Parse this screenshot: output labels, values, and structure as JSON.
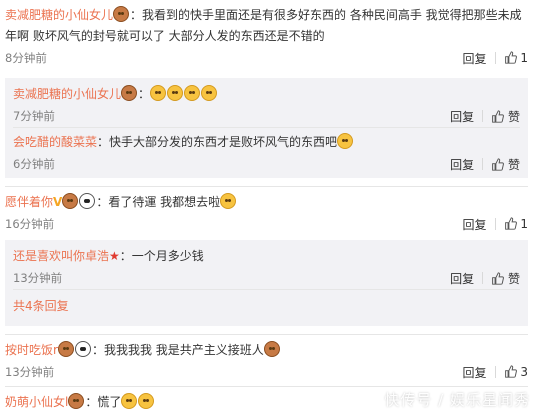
{
  "comments": [
    {
      "user": "卖减肥糖的小仙女儿",
      "line1": "：我看到的快手里面还是有很多好东西的 各种民间高手 我觉得把那些未成",
      "line2": "年啊 败坏风气的封号就可以了  大部分人发的东西还是不错的",
      "time": "8分钟前",
      "reply_label": "回复",
      "likes": "1"
    },
    {
      "user": "愿伴着你",
      "text": "：看了待運  我都想去啦",
      "time": "16分钟前",
      "reply_label": "回复",
      "likes": "1"
    },
    {
      "user": "按时吃饭r",
      "text": "：我我我我  我是共产主义接班人",
      "time": "13分钟前",
      "reply_label": "回复",
      "likes": "3"
    },
    {
      "user": "奶萌小仙女l",
      "text": "：慌了"
    }
  ],
  "replies1": [
    {
      "user": "卖减肥糖的小仙女儿",
      "text": "：",
      "time": "7分钟前",
      "reply_label": "回复",
      "like_label": "赞"
    },
    {
      "user": "会吃醋的酸菜菜",
      "text": "：快手大部分发的东西才是败坏风气的东西吧",
      "time": "6分钟前",
      "reply_label": "回复",
      "like_label": "赞"
    }
  ],
  "replies2": [
    {
      "user": "还是喜欢叫你卓浩",
      "text": "：一个月多少钱",
      "time": "13分钟前",
      "reply_label": "回复",
      "like_label": "赞"
    }
  ],
  "more_replies": "共4条回复",
  "watermark": "快传号 / 娱乐星闻秀",
  "colors": {
    "username": "#eb7350",
    "reply_bg": "#f2f2f5",
    "time": "#808080"
  }
}
